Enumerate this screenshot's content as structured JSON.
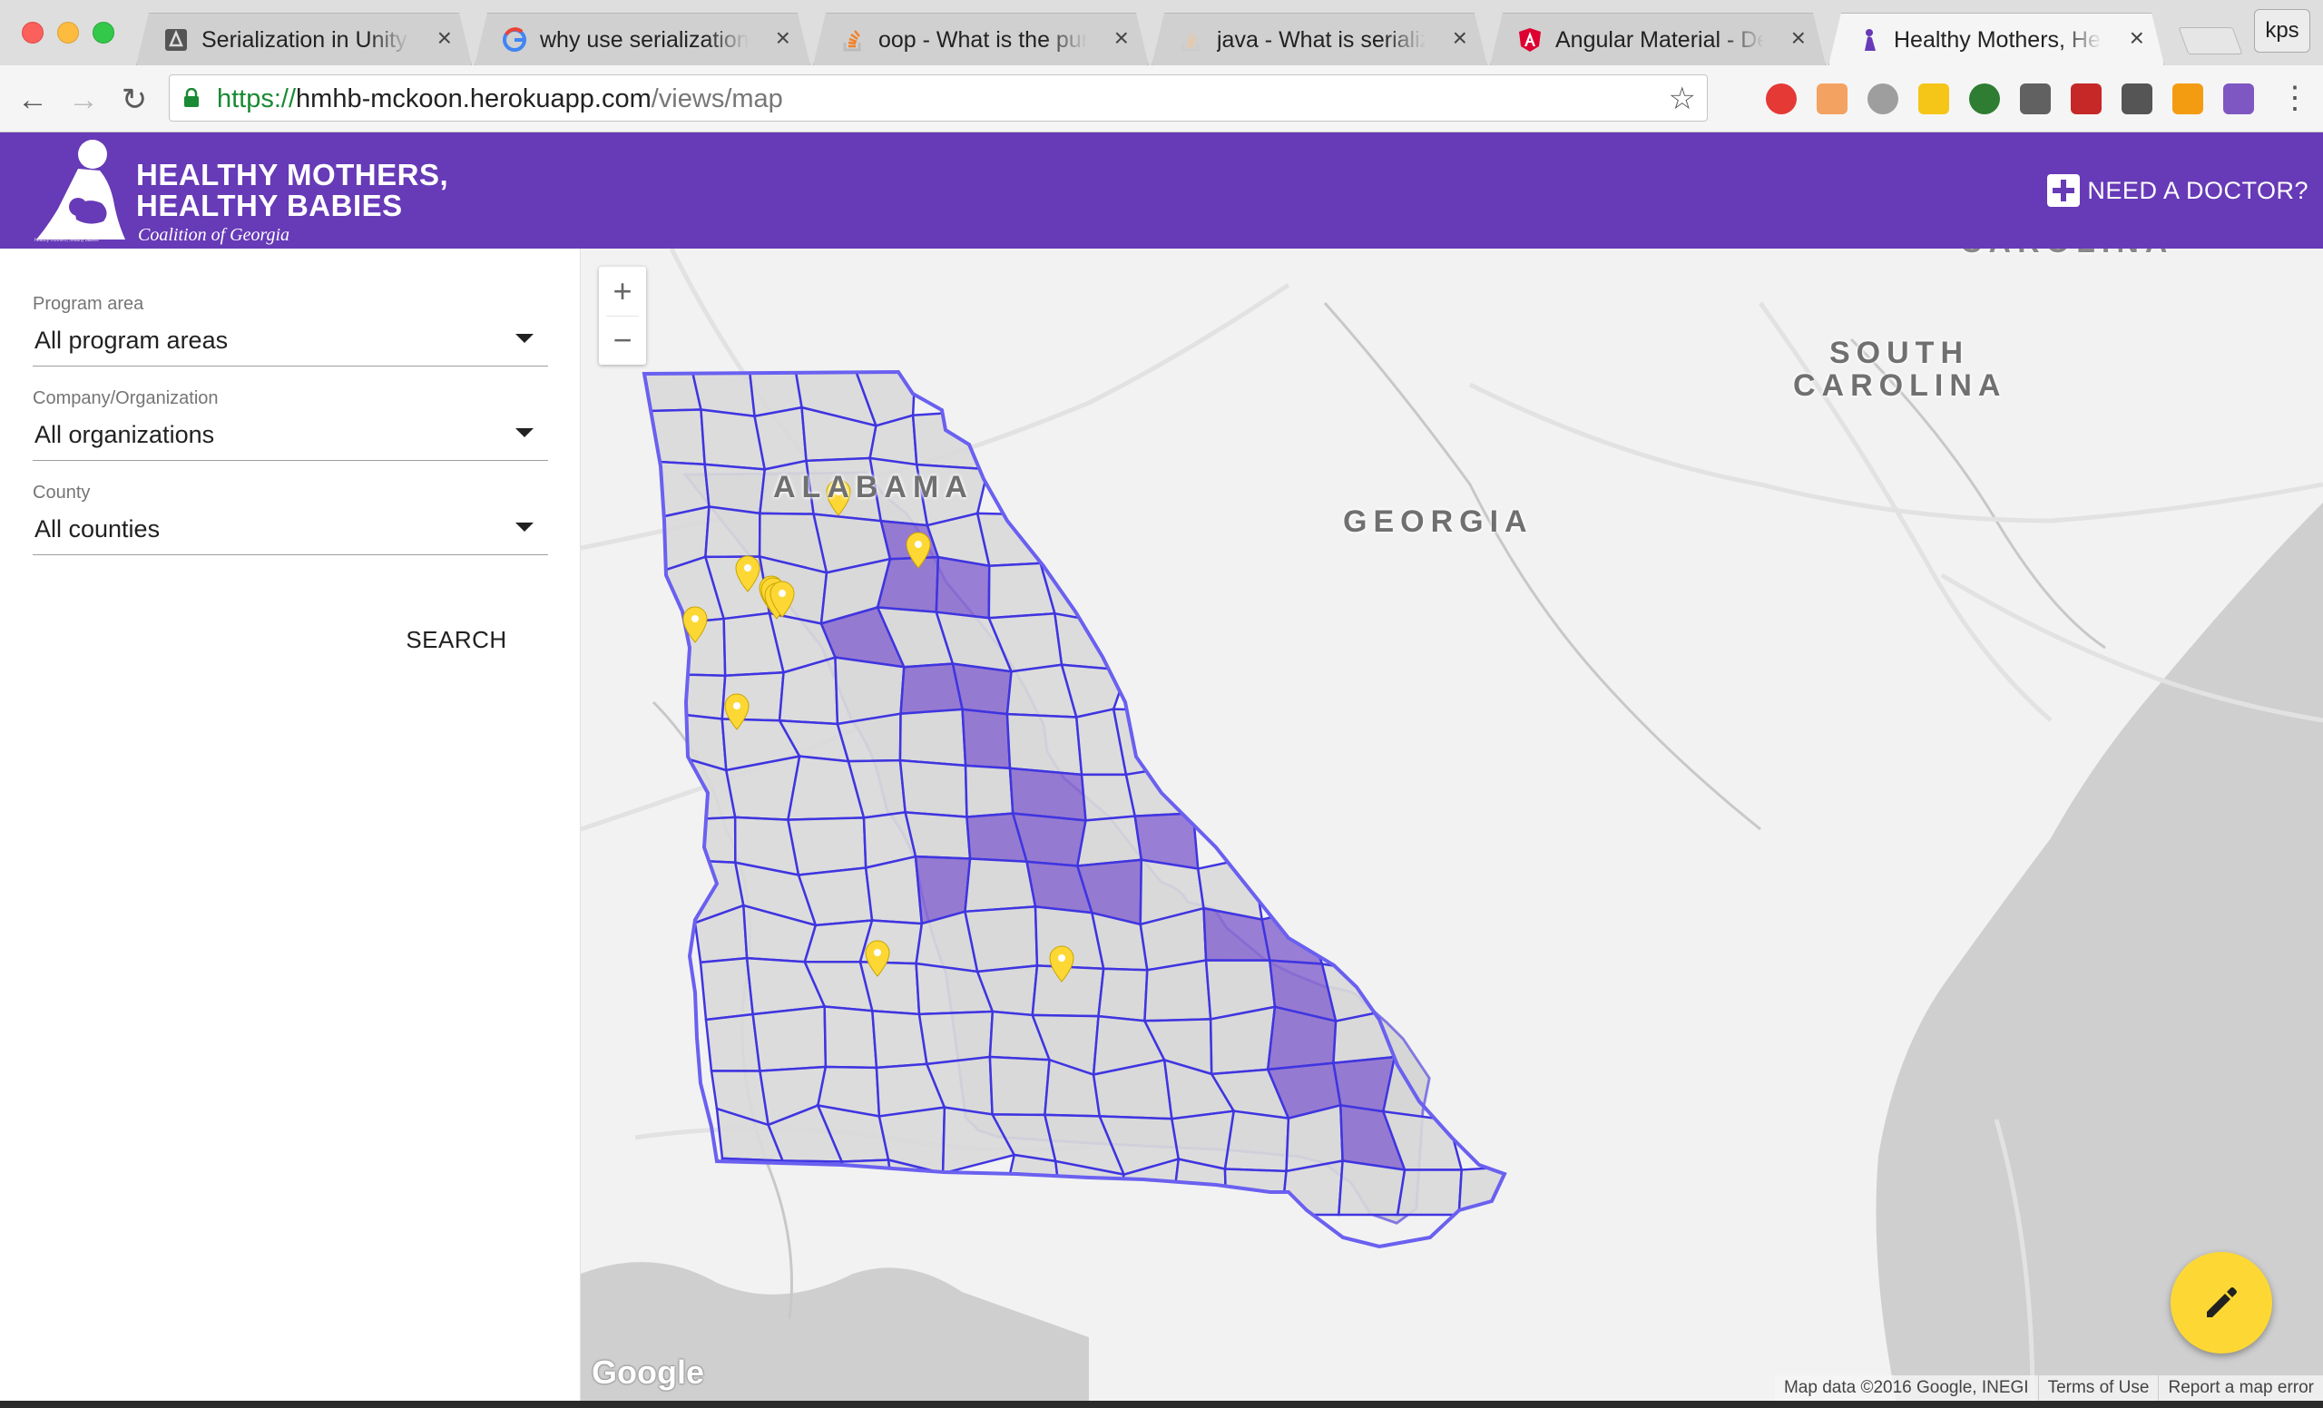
{
  "browser": {
    "tabs": [
      {
        "title": "Serialization in Unity – Unity Blog",
        "icon": "unity-icon",
        "active": false
      },
      {
        "title": "why use serialization in unity - Google Search",
        "icon": "google-icon",
        "active": false
      },
      {
        "title": "oop - What is the purpose of Serialization",
        "icon": "stackoverflow-icon",
        "active": false
      },
      {
        "title": "java - What is serialization?",
        "icon": "stackoverflow-icon",
        "active": false
      },
      {
        "title": "Angular Material - Demos",
        "icon": "angular-icon",
        "active": false
      },
      {
        "title": "Healthy Mothers, Healthy Babies",
        "icon": "hmhb-icon",
        "active": true
      }
    ],
    "profile": "kps",
    "url": {
      "scheme": "https://",
      "host": "hmhb-mckoon.herokuapp.com",
      "path": "/views/map"
    }
  },
  "header": {
    "logo_line1": "HEALTHY MOTHERS,",
    "logo_line2": "HEALTHY BABIES",
    "logo_line3": "Coalition of Georgia",
    "logo_tagline": "healthy mothers, healthy babies",
    "need_doctor": "NEED A DOCTOR?",
    "brand_color": "#673ab7"
  },
  "filters": {
    "program": {
      "label": "Program area",
      "value": "All program areas"
    },
    "organization": {
      "label": "Company/Organization",
      "value": "All organizations"
    },
    "county": {
      "label": "County",
      "value": "All counties"
    },
    "search": "SEARCH"
  },
  "map": {
    "labels": {
      "alabama": "ALABAMA",
      "georgia": "GEORGIA",
      "south_carolina_1": "SOUTH",
      "south_carolina_2": "CAROLINA",
      "carolina_top": "CAROLINA"
    },
    "zoom_in": "+",
    "zoom_out": "−",
    "google": "Google",
    "attribution": {
      "data": "Map data ©2016 Google, INEGI",
      "terms": "Terms of Use",
      "report": "Report a map error"
    },
    "highlight_color": "#8a6ad0",
    "marker_color": "#fdd835",
    "marker_count": 11
  }
}
